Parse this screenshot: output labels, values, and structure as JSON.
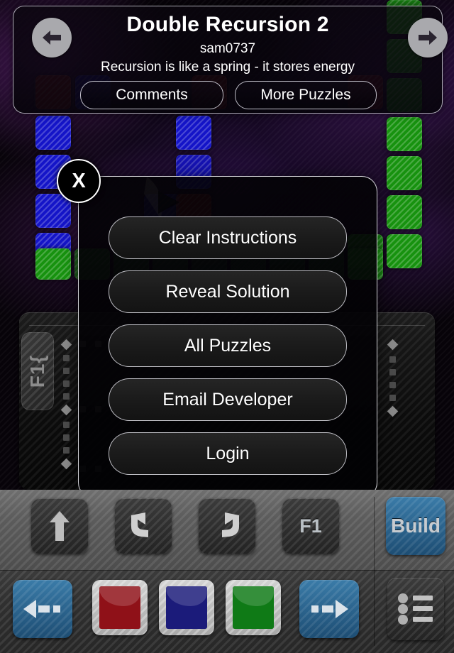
{
  "header": {
    "title": "Double Recursion 2",
    "author": "sam0737",
    "description": "Recursion is like a spring - it stores energy",
    "comments_label": "Comments",
    "more_puzzles_label": "More Puzzles",
    "prev_icon": "arrow-left-icon",
    "next_icon": "arrow-right-icon"
  },
  "modal": {
    "close_label": "X",
    "items": [
      {
        "label": "Clear Instructions"
      },
      {
        "label": "Reveal Solution"
      },
      {
        "label": "All Puzzles"
      },
      {
        "label": "Email Developer"
      },
      {
        "label": "Login"
      }
    ]
  },
  "program": {
    "function_label": "F1{"
  },
  "toolbar_top": {
    "step_label": "",
    "undo_label": "",
    "redo_label": "",
    "f1_label": "F1",
    "build_label": "Build"
  },
  "toolbar_bottom": {
    "prev_label": "",
    "next_label": "",
    "menu_label": "",
    "swatches": [
      {
        "name": "red",
        "color": "#8f1118"
      },
      {
        "name": "blue",
        "color": "#1b1b7a"
      },
      {
        "name": "green",
        "color": "#0f7a16"
      }
    ]
  },
  "colors": {
    "accent_blue": "#2c6490",
    "cell_blue": "#1414c8",
    "cell_green": "#17920f",
    "cell_red": "#8a1414"
  }
}
